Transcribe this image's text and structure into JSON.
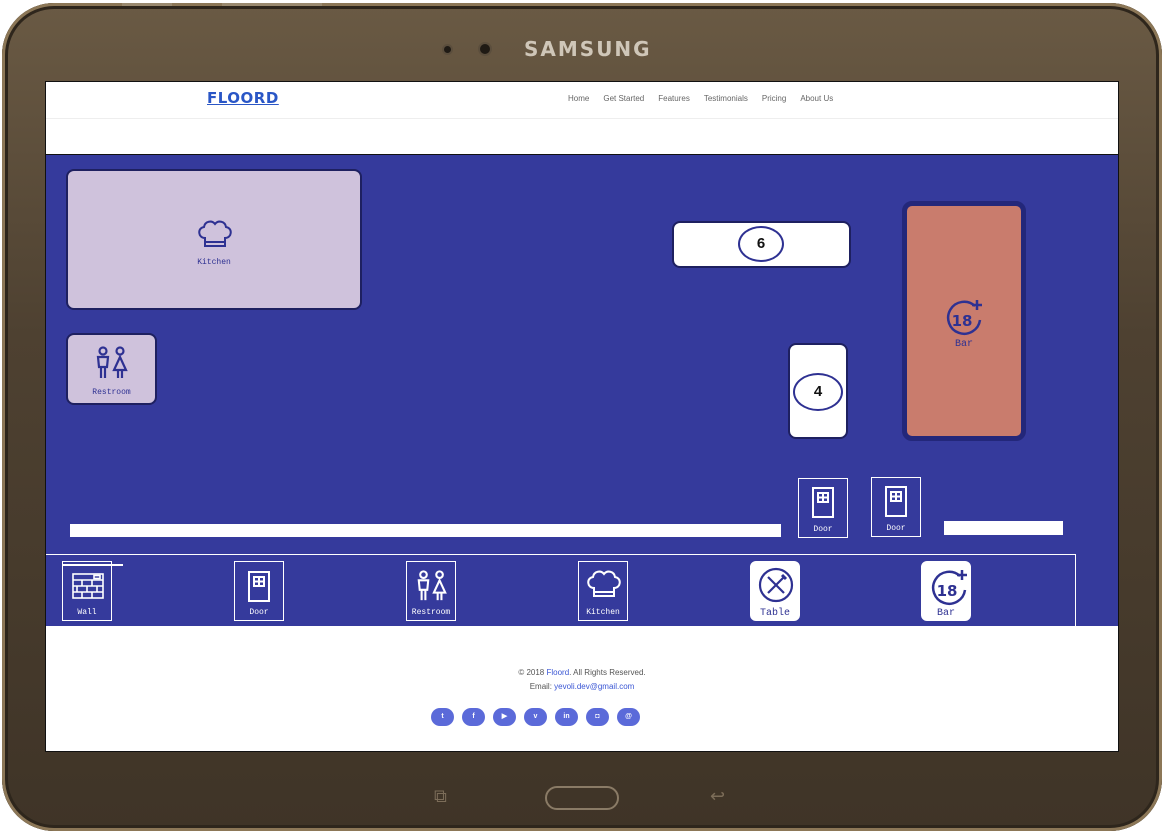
{
  "device": {
    "brand": "SAMSUNG"
  },
  "app": {
    "logo": "FLOORD"
  },
  "nav": {
    "items": [
      {
        "label": "Home"
      },
      {
        "label": "Get Started"
      },
      {
        "label": "Features"
      },
      {
        "label": "Testimonials"
      },
      {
        "label": "Pricing"
      },
      {
        "label": "About Us"
      }
    ]
  },
  "floor": {
    "kitchen": {
      "label": "Kitchen",
      "icon": "chef-hat-icon"
    },
    "restroom": {
      "label": "Restroom",
      "icon": "restroom-icon"
    },
    "table_6": {
      "seats": "6"
    },
    "table_4": {
      "seats": "4"
    },
    "bar": {
      "badge": "18+",
      "label": "Bar",
      "icon": "age-18-plus-icon"
    },
    "doors": [
      {
        "label": "Door"
      },
      {
        "label": "Door"
      }
    ]
  },
  "palette": {
    "items": [
      {
        "label": "Wall",
        "icon": "brick-wall-icon"
      },
      {
        "label": "Door",
        "icon": "door-icon"
      },
      {
        "label": "Restroom",
        "icon": "restroom-icon"
      },
      {
        "label": "Kitchen",
        "icon": "chef-hat-icon"
      },
      {
        "label": "Table",
        "icon": "fork-knife-icon"
      },
      {
        "label": "Bar",
        "icon": "age-18-plus-icon"
      }
    ]
  },
  "footer": {
    "copyright_pre": "© 2018",
    "brand": "Floord",
    "copyright_post": ". All Rights Reserved.",
    "email_label": "Email:",
    "email": "yevoli.dev@gmail.com",
    "socials": [
      {
        "icon": "twitter-icon",
        "glyph": "t"
      },
      {
        "icon": "facebook-icon",
        "glyph": "f"
      },
      {
        "icon": "youtube-icon",
        "glyph": "▶"
      },
      {
        "icon": "vimeo-icon",
        "glyph": "v"
      },
      {
        "icon": "linkedin-icon",
        "glyph": "in"
      },
      {
        "icon": "instagram-icon",
        "glyph": "◘"
      },
      {
        "icon": "email-icon",
        "glyph": "@"
      }
    ]
  },
  "colors": {
    "floor_bg": "#353a9c",
    "kitchen_fill": "#cfc2dc",
    "bar_fill": "#c97c6d",
    "accent": "#3a56d4"
  }
}
